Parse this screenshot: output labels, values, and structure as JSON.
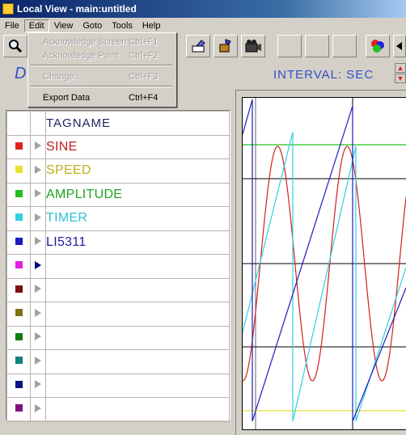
{
  "window": {
    "title": "Local View - main:untitled"
  },
  "menubar": {
    "items": [
      "File",
      "Edit",
      "View",
      "Goto",
      "Tools",
      "Help"
    ]
  },
  "edit_menu": {
    "items": [
      {
        "label": "Acknowledge Screen",
        "shortcut": "Ctrl+F1",
        "enabled": false
      },
      {
        "label": "Acknowledge Point",
        "shortcut": "Ctrl+F2",
        "enabled": false
      },
      {
        "label": "Change...",
        "shortcut": "Ctrl+F3",
        "enabled": false
      },
      {
        "label": "Export Data",
        "shortcut": "Ctrl+F4",
        "enabled": true
      }
    ]
  },
  "header": {
    "label_fragment": "D",
    "interval": "INTERVAL: SEC"
  },
  "tag_table": {
    "column_header": "TAGNAME",
    "rows": [
      {
        "name": "SINE",
        "color": "#e02020",
        "selected": false
      },
      {
        "name": "SPEED",
        "color": "#e8e030",
        "selected": false
      },
      {
        "name": "AMPLITUDE",
        "color": "#20c020",
        "selected": false
      },
      {
        "name": "TIMER",
        "color": "#30d0e0",
        "selected": false
      },
      {
        "name": "LI5311",
        "color": "#1c1cc0",
        "selected": false
      },
      {
        "name": "",
        "color": "#e020e0",
        "selected": true
      },
      {
        "name": "",
        "color": "#801010",
        "selected": false
      },
      {
        "name": "",
        "color": "#807010",
        "selected": false
      },
      {
        "name": "",
        "color": "#108010",
        "selected": false
      },
      {
        "name": "",
        "color": "#108080",
        "selected": false
      },
      {
        "name": "",
        "color": "#101080",
        "selected": false
      },
      {
        "name": "",
        "color": "#801080",
        "selected": false
      }
    ],
    "text_colors": [
      "#c02020",
      "#c0b020",
      "#20a020",
      "#30c0d0",
      "#1c1ca0"
    ]
  },
  "chart_data": {
    "type": "line",
    "title": "",
    "xlabel": "",
    "ylabel": "",
    "grid": true,
    "series": [
      {
        "name": "SINE",
        "color": "#d02020",
        "shape": "sine"
      },
      {
        "name": "SPEED",
        "color": "#e8e030",
        "shape": "flat"
      },
      {
        "name": "AMPLITUDE",
        "color": "#20c020",
        "shape": "flat"
      },
      {
        "name": "TIMER",
        "color": "#30d0e0",
        "shape": "sawtooth"
      },
      {
        "name": "LI5311",
        "color": "#1c1cc0",
        "shape": "sawtooth"
      }
    ]
  }
}
